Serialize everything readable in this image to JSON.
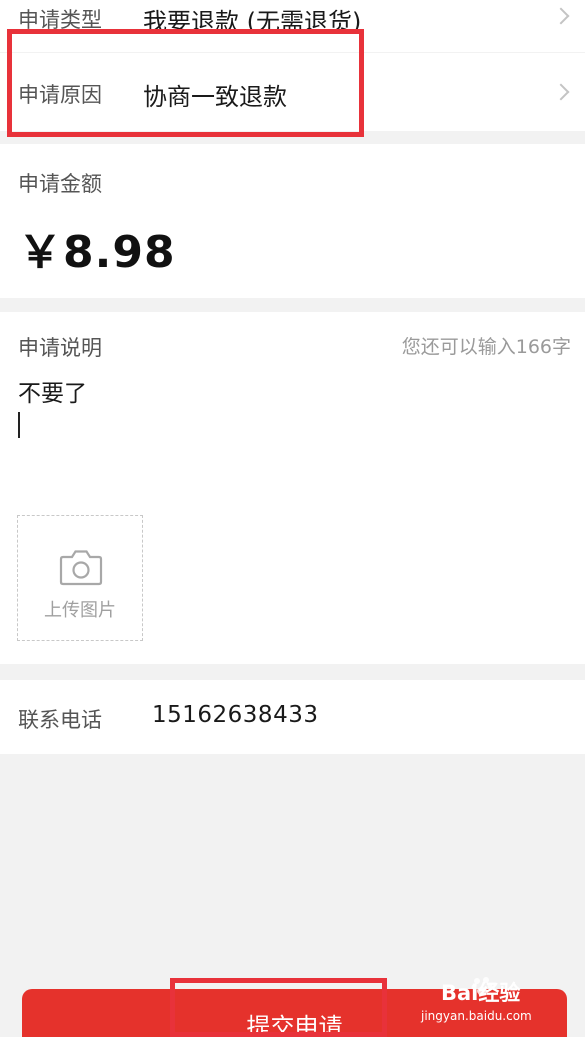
{
  "form": {
    "type": {
      "label": "申请类型",
      "value": "我要退款 (无需退货)"
    },
    "reason": {
      "label": "申请原因",
      "value": "协商一致退款"
    },
    "amount": {
      "label": "申请金额",
      "value": "￥8.98"
    },
    "description": {
      "label": "申请说明",
      "counter": "您还可以输入166字",
      "text": "不要了"
    },
    "upload": {
      "label": "上传图片",
      "icon": "camera-icon"
    },
    "phone": {
      "label": "联系电话",
      "value": "15162638433"
    }
  },
  "submit": {
    "label": "提交申请"
  },
  "watermark": {
    "brand": "Bai经验",
    "url": "jingyan.baidu.com"
  },
  "colors": {
    "accent": "#e5322c",
    "highlight": "#e8323a",
    "background": "#f2f2f2"
  }
}
